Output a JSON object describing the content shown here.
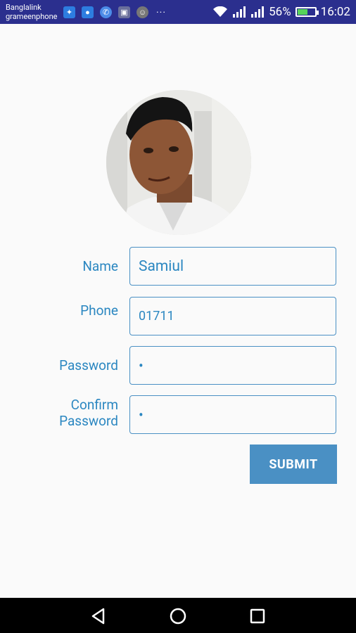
{
  "status_bar": {
    "carrier_1": "Banglalink",
    "carrier_2": "grameenphone",
    "battery": "56%",
    "time": "16:02",
    "icons": [
      "notification-icon",
      "messenger-icon",
      "phone-icon",
      "image-icon",
      "avatar-notification-icon",
      "more-dots-icon",
      "wifi-icon",
      "signal-icon",
      "signal-icon",
      "battery-icon"
    ]
  },
  "form": {
    "name_label": "Name",
    "name_value": "Samiul",
    "phone_label": "Phone",
    "phone_value": "01711",
    "password_label": "Password",
    "password_value": "•",
    "confirm_label_line1": "Confirm",
    "confirm_label_line2": "Password",
    "confirm_value": "•",
    "submit_label": "SUBMIT"
  },
  "nav": {
    "icons": [
      "back-icon",
      "home-icon",
      "recents-icon"
    ]
  },
  "colors": {
    "accent": "#4a90c4",
    "label": "#2b87c1",
    "status_bar": "#2b2f8e"
  }
}
